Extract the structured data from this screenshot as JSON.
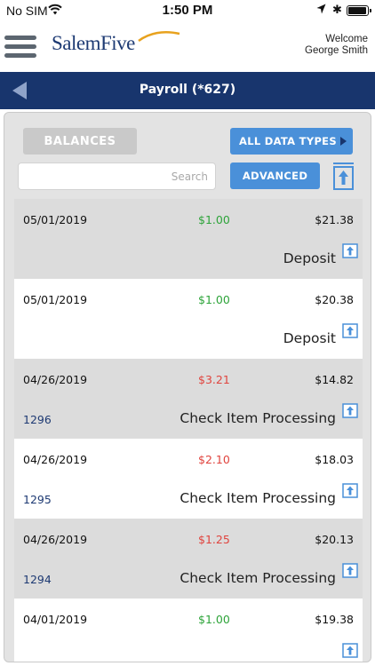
{
  "status_bar": {
    "carrier": "No SIM",
    "time": "1:50 PM"
  },
  "header": {
    "logo": "SalemFive",
    "welcome_line1": "Welcome",
    "welcome_line2": "George Smith"
  },
  "nav": {
    "title": "Payroll (*627)"
  },
  "controls": {
    "balances_label": "BALANCES",
    "data_types_label": "ALL DATA TYPES",
    "search_placeholder": "Search",
    "search_value": "",
    "advanced_label": "ADVANCED"
  },
  "colors": {
    "nav_blue": "#18356d",
    "button_blue": "#4a90d9",
    "positive_green": "#2ea43a",
    "negative_red": "#e0443e"
  },
  "transactions": [
    {
      "date": "05/01/2019",
      "amount": "$1.00",
      "amount_type": "pos",
      "balance": "$21.38",
      "check": "",
      "description": "Deposit"
    },
    {
      "date": "05/01/2019",
      "amount": "$1.00",
      "amount_type": "pos",
      "balance": "$20.38",
      "check": "",
      "description": "Deposit"
    },
    {
      "date": "04/26/2019",
      "amount": "$3.21",
      "amount_type": "neg",
      "balance": "$14.82",
      "check": "1296",
      "description": "Check Item Processing"
    },
    {
      "date": "04/26/2019",
      "amount": "$2.10",
      "amount_type": "neg",
      "balance": "$18.03",
      "check": "1295",
      "description": "Check Item Processing"
    },
    {
      "date": "04/26/2019",
      "amount": "$1.25",
      "amount_type": "neg",
      "balance": "$20.13",
      "check": "1294",
      "description": "Check Item Processing"
    },
    {
      "date": "04/01/2019",
      "amount": "$1.00",
      "amount_type": "pos",
      "balance": "$19.38",
      "check": "",
      "description": ""
    }
  ]
}
